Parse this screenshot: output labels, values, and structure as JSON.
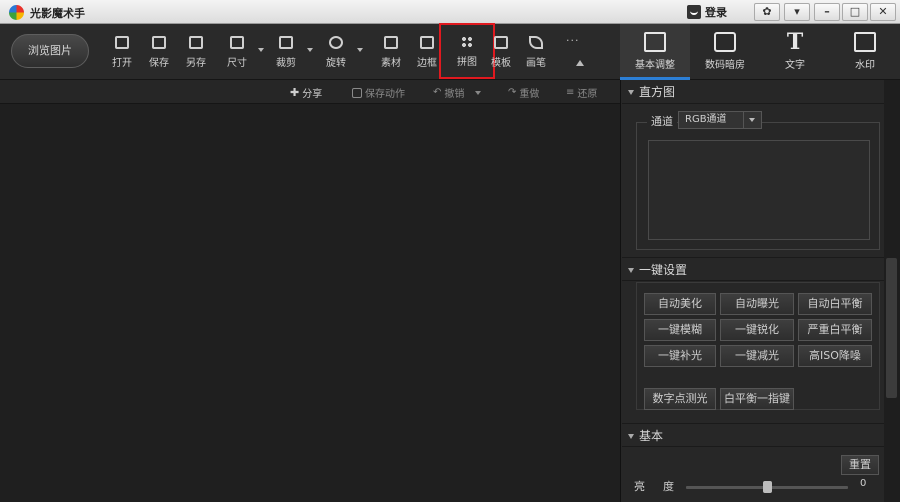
{
  "window": {
    "title": "光影魔术手",
    "login": "登录"
  },
  "toolbar": {
    "browse": "浏览图片",
    "tools": [
      {
        "label": "打开"
      },
      {
        "label": "保存"
      },
      {
        "label": "另存"
      },
      {
        "label": "尺寸"
      },
      {
        "label": "裁剪"
      },
      {
        "label": "旋转"
      },
      {
        "label": "素材"
      },
      {
        "label": "边框"
      },
      {
        "label": "拼图"
      },
      {
        "label": "模板"
      },
      {
        "label": "画笔"
      }
    ],
    "more": "···"
  },
  "tabs": [
    {
      "label": "基本调整",
      "icon": "edit-icon"
    },
    {
      "label": "数码暗房",
      "icon": "camera-icon"
    },
    {
      "label": "文字",
      "icon": "text-icon"
    },
    {
      "label": "水印",
      "icon": "watermark-icon"
    }
  ],
  "subbar": {
    "share": "分享",
    "save_action": "保存动作",
    "undo": "撤销",
    "redo": "重做",
    "restore": "还原"
  },
  "histogram": {
    "title": "直方图",
    "channel_label": "通道",
    "channel_value": "RGB通道"
  },
  "one_click": {
    "title": "一键设置",
    "buttons": [
      "自动美化",
      "自动曝光",
      "自动白平衡",
      "一键模糊",
      "一键锐化",
      "严重白平衡",
      "一键补光",
      "一键减光",
      "高ISO降噪",
      "数字点测光",
      "白平衡一指键"
    ]
  },
  "basic": {
    "title": "基本",
    "reset": "重置",
    "brightness_label": "亮度",
    "brightness_value": "0"
  }
}
